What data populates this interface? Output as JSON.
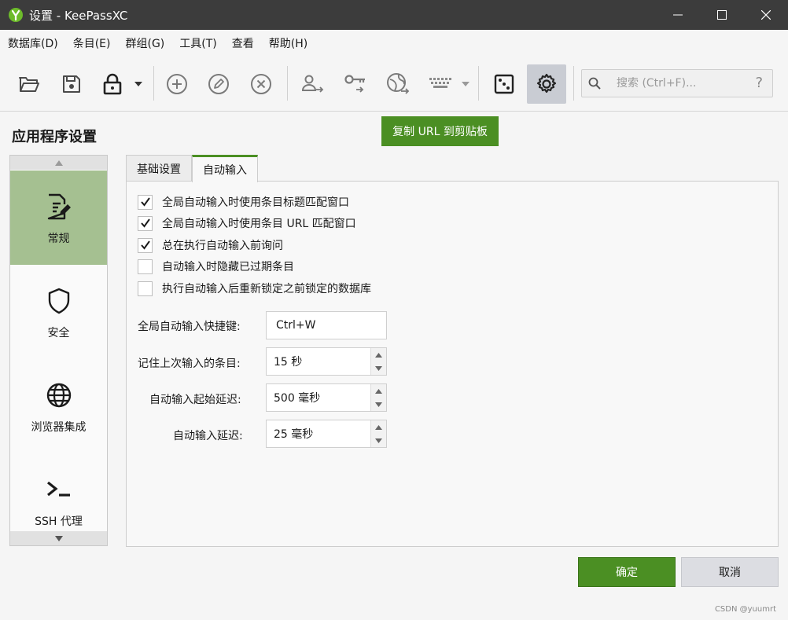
{
  "window": {
    "title": "设置 - KeePassXC",
    "controls": [
      "minimize",
      "maximize",
      "close"
    ]
  },
  "menu": {
    "items": [
      "数据库(D)",
      "条目(E)",
      "群组(G)",
      "工具(T)",
      "查看",
      "帮助(H)"
    ]
  },
  "toolbar": {
    "buttons": [
      {
        "icon": "folder-open-icon"
      },
      {
        "icon": "save-icon"
      },
      {
        "icon": "lock-icon"
      },
      {
        "icon": "add-entry-icon"
      },
      {
        "icon": "edit-entry-icon"
      },
      {
        "icon": "delete-entry-icon"
      },
      {
        "icon": "copy-username-icon"
      },
      {
        "icon": "copy-password-icon"
      },
      {
        "icon": "copy-url-icon"
      },
      {
        "icon": "keyboard-icon"
      },
      {
        "icon": "dice-icon"
      },
      {
        "icon": "settings-icon",
        "active": true
      }
    ]
  },
  "search": {
    "placeholder": "搜索 (Ctrl+F)...",
    "help": "?"
  },
  "tooltip": {
    "text": "复制 URL 到剪贴板"
  },
  "page": {
    "title": "应用程序设置"
  },
  "categories": [
    {
      "label": "常规",
      "icon": "general-icon",
      "selected": true
    },
    {
      "label": "安全",
      "icon": "shield-icon"
    },
    {
      "label": "浏览器集成",
      "icon": "globe-icon"
    },
    {
      "label": "SSH 代理",
      "icon": "terminal-icon"
    }
  ],
  "tabs": [
    {
      "label": "基础设置",
      "active": false
    },
    {
      "label": "自动输入",
      "active": true
    }
  ],
  "autotype": {
    "checkboxes": [
      {
        "label": "全局自动输入时使用条目标题匹配窗口",
        "checked": true
      },
      {
        "label": "全局自动输入时使用条目 URL 匹配窗口",
        "checked": true
      },
      {
        "label": "总在执行自动输入前询问",
        "checked": true
      },
      {
        "label": "自动输入时隐藏已过期条目",
        "checked": false
      },
      {
        "label": "执行自动输入后重新锁定之前锁定的数据库",
        "checked": false
      }
    ],
    "fields": {
      "shortcut": {
        "label": "全局自动输入快捷键:",
        "value": "Ctrl+W"
      },
      "remember": {
        "label": "记住上次输入的条目:",
        "value": "15 秒"
      },
      "start_delay": {
        "label": "自动输入起始延迟:",
        "value": "500 毫秒"
      },
      "delay": {
        "label": "自动输入延迟:",
        "value": "25 毫秒"
      }
    }
  },
  "buttons": {
    "ok": "确定",
    "cancel": "取消"
  },
  "watermark": "CSDN @yuumrt",
  "colors": {
    "accent": "#4b8f23",
    "selected_category": "#a5c091",
    "titlebar": "#3c3c3c"
  }
}
